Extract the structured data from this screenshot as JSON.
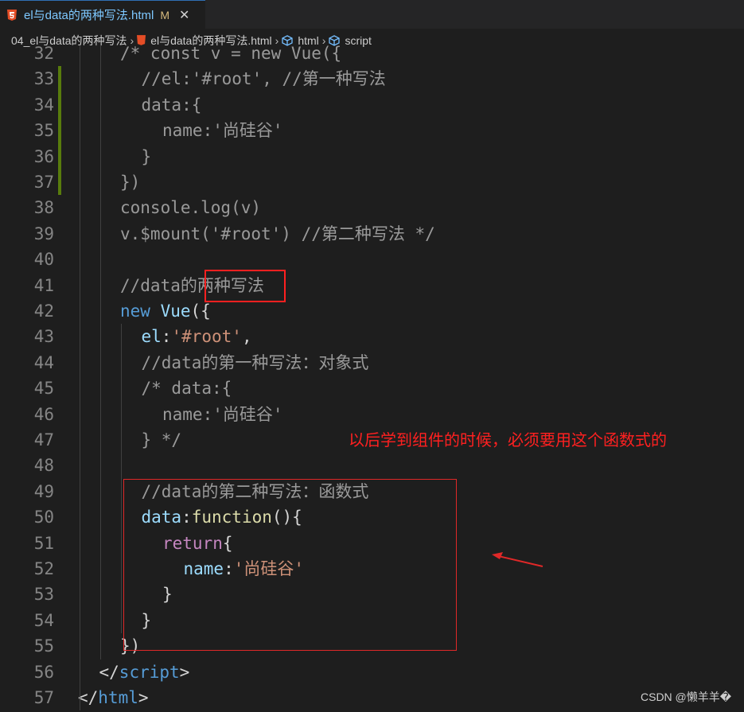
{
  "tab": {
    "icon": "html5-file-icon",
    "label": "el与data的两种写法.html",
    "status": "M",
    "close": "✕"
  },
  "breadcrumb": {
    "items": [
      "04_el与data的两种写法",
      "el与data的两种写法.html",
      "html",
      "script"
    ]
  },
  "lines": [
    {
      "n": "32",
      "indent": 2,
      "tokens": [
        [
          "c-comment",
          "/* const v = new Vue({"
        ]
      ]
    },
    {
      "n": "33",
      "indent": 3,
      "tokens": [
        [
          "c-comment",
          "//el:'#root', //第一种写法"
        ]
      ]
    },
    {
      "n": "34",
      "indent": 3,
      "tokens": [
        [
          "c-comment",
          "data:{"
        ]
      ]
    },
    {
      "n": "35",
      "indent": 4,
      "tokens": [
        [
          "c-comment",
          "name:'尚硅谷'"
        ]
      ]
    },
    {
      "n": "36",
      "indent": 3,
      "tokens": [
        [
          "c-comment",
          "}"
        ]
      ]
    },
    {
      "n": "37",
      "indent": 2,
      "tokens": [
        [
          "c-comment",
          "})"
        ]
      ]
    },
    {
      "n": "38",
      "indent": 2,
      "tokens": [
        [
          "c-comment",
          "console.log(v)"
        ]
      ]
    },
    {
      "n": "39",
      "indent": 2,
      "tokens": [
        [
          "c-comment",
          "v.$mount('#root') //第二种写法 */"
        ]
      ]
    },
    {
      "n": "40",
      "indent": 0,
      "tokens": []
    },
    {
      "n": "41",
      "indent": 2,
      "tokens": [
        [
          "c-comment",
          "//data的两种写法"
        ]
      ]
    },
    {
      "n": "42",
      "indent": 2,
      "tokens": [
        [
          "c-kw",
          "new "
        ],
        [
          "c-key",
          "Vue"
        ],
        [
          "c-punc",
          "({"
        ]
      ]
    },
    {
      "n": "43",
      "indent": 3,
      "tokens": [
        [
          "c-key",
          "el"
        ],
        [
          "c-punc",
          ":"
        ],
        [
          "c-str",
          "'#root'"
        ],
        [
          "c-punc",
          ","
        ]
      ]
    },
    {
      "n": "44",
      "indent": 3,
      "tokens": [
        [
          "c-comment",
          "//data的第一种写法：对象式"
        ]
      ]
    },
    {
      "n": "45",
      "indent": 3,
      "tokens": [
        [
          "c-comment",
          "/* data:{"
        ]
      ]
    },
    {
      "n": "46",
      "indent": 4,
      "tokens": [
        [
          "c-comment",
          "name:'尚硅谷'"
        ]
      ]
    },
    {
      "n": "47",
      "indent": 3,
      "tokens": [
        [
          "c-comment",
          "} */"
        ]
      ]
    },
    {
      "n": "48",
      "indent": 0,
      "tokens": []
    },
    {
      "n": "49",
      "indent": 3,
      "tokens": [
        [
          "c-comment",
          "//data的第二种写法：函数式"
        ]
      ]
    },
    {
      "n": "50",
      "indent": 3,
      "tokens": [
        [
          "c-key",
          "data"
        ],
        [
          "c-punc",
          ":"
        ],
        [
          "c-fn",
          "function"
        ],
        [
          "c-punc",
          "(){"
        ]
      ]
    },
    {
      "n": "51",
      "indent": 4,
      "tokens": [
        [
          "c-ctrl",
          "return"
        ],
        [
          "c-punc",
          "{"
        ]
      ]
    },
    {
      "n": "52",
      "indent": 5,
      "tokens": [
        [
          "c-key",
          "name"
        ],
        [
          "c-punc",
          ":"
        ],
        [
          "c-str",
          "'尚硅谷'"
        ]
      ]
    },
    {
      "n": "53",
      "indent": 4,
      "tokens": [
        [
          "c-punc",
          "}"
        ]
      ]
    },
    {
      "n": "54",
      "indent": 3,
      "tokens": [
        [
          "c-punc",
          "}"
        ]
      ]
    },
    {
      "n": "55",
      "indent": 2,
      "tokens": [
        [
          "c-punc",
          "})"
        ]
      ]
    },
    {
      "n": "56",
      "indent": 1,
      "tokens": [
        [
          "c-punc",
          "</"
        ],
        [
          "c-tag",
          "script"
        ],
        [
          "c-punc",
          ">"
        ]
      ]
    },
    {
      "n": "57",
      "indent": 0,
      "tokens": [
        [
          "c-punc",
          "</"
        ],
        [
          "c-tag",
          "html"
        ],
        [
          "c-punc",
          ">"
        ]
      ]
    }
  ],
  "annotation": {
    "text": "以后学到组件的时候，必须要用这个函数式的"
  },
  "watermark": "CSDN @懒羊羊�",
  "colors": {
    "accent_red": "#ff2020",
    "modified_bar": "#587c0c"
  }
}
